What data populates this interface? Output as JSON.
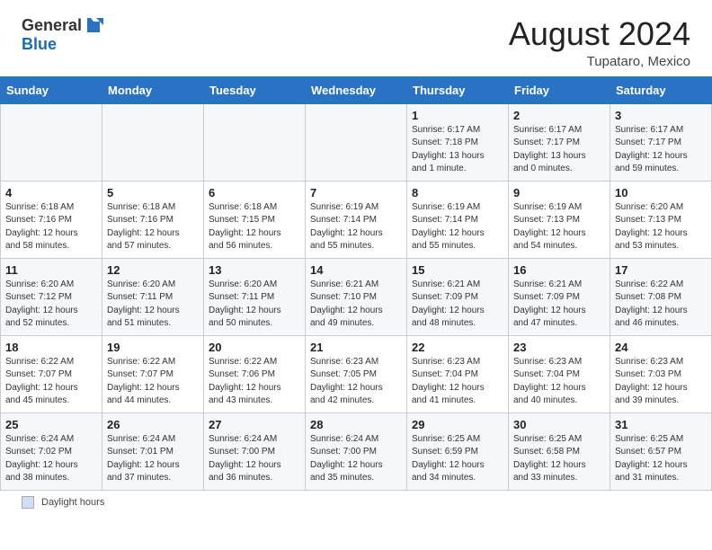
{
  "header": {
    "logo_line1": "General",
    "logo_line2": "Blue",
    "month_year": "August 2024",
    "location": "Tupataro, Mexico"
  },
  "days_of_week": [
    "Sunday",
    "Monday",
    "Tuesday",
    "Wednesday",
    "Thursday",
    "Friday",
    "Saturday"
  ],
  "weeks": [
    [
      {
        "day": "",
        "info": ""
      },
      {
        "day": "",
        "info": ""
      },
      {
        "day": "",
        "info": ""
      },
      {
        "day": "",
        "info": ""
      },
      {
        "day": "1",
        "info": "Sunrise: 6:17 AM\nSunset: 7:18 PM\nDaylight: 13 hours\nand 1 minute."
      },
      {
        "day": "2",
        "info": "Sunrise: 6:17 AM\nSunset: 7:17 PM\nDaylight: 13 hours\nand 0 minutes."
      },
      {
        "day": "3",
        "info": "Sunrise: 6:17 AM\nSunset: 7:17 PM\nDaylight: 12 hours\nand 59 minutes."
      }
    ],
    [
      {
        "day": "4",
        "info": "Sunrise: 6:18 AM\nSunset: 7:16 PM\nDaylight: 12 hours\nand 58 minutes."
      },
      {
        "day": "5",
        "info": "Sunrise: 6:18 AM\nSunset: 7:16 PM\nDaylight: 12 hours\nand 57 minutes."
      },
      {
        "day": "6",
        "info": "Sunrise: 6:18 AM\nSunset: 7:15 PM\nDaylight: 12 hours\nand 56 minutes."
      },
      {
        "day": "7",
        "info": "Sunrise: 6:19 AM\nSunset: 7:14 PM\nDaylight: 12 hours\nand 55 minutes."
      },
      {
        "day": "8",
        "info": "Sunrise: 6:19 AM\nSunset: 7:14 PM\nDaylight: 12 hours\nand 55 minutes."
      },
      {
        "day": "9",
        "info": "Sunrise: 6:19 AM\nSunset: 7:13 PM\nDaylight: 12 hours\nand 54 minutes."
      },
      {
        "day": "10",
        "info": "Sunrise: 6:20 AM\nSunset: 7:13 PM\nDaylight: 12 hours\nand 53 minutes."
      }
    ],
    [
      {
        "day": "11",
        "info": "Sunrise: 6:20 AM\nSunset: 7:12 PM\nDaylight: 12 hours\nand 52 minutes."
      },
      {
        "day": "12",
        "info": "Sunrise: 6:20 AM\nSunset: 7:11 PM\nDaylight: 12 hours\nand 51 minutes."
      },
      {
        "day": "13",
        "info": "Sunrise: 6:20 AM\nSunset: 7:11 PM\nDaylight: 12 hours\nand 50 minutes."
      },
      {
        "day": "14",
        "info": "Sunrise: 6:21 AM\nSunset: 7:10 PM\nDaylight: 12 hours\nand 49 minutes."
      },
      {
        "day": "15",
        "info": "Sunrise: 6:21 AM\nSunset: 7:09 PM\nDaylight: 12 hours\nand 48 minutes."
      },
      {
        "day": "16",
        "info": "Sunrise: 6:21 AM\nSunset: 7:09 PM\nDaylight: 12 hours\nand 47 minutes."
      },
      {
        "day": "17",
        "info": "Sunrise: 6:22 AM\nSunset: 7:08 PM\nDaylight: 12 hours\nand 46 minutes."
      }
    ],
    [
      {
        "day": "18",
        "info": "Sunrise: 6:22 AM\nSunset: 7:07 PM\nDaylight: 12 hours\nand 45 minutes."
      },
      {
        "day": "19",
        "info": "Sunrise: 6:22 AM\nSunset: 7:07 PM\nDaylight: 12 hours\nand 44 minutes."
      },
      {
        "day": "20",
        "info": "Sunrise: 6:22 AM\nSunset: 7:06 PM\nDaylight: 12 hours\nand 43 minutes."
      },
      {
        "day": "21",
        "info": "Sunrise: 6:23 AM\nSunset: 7:05 PM\nDaylight: 12 hours\nand 42 minutes."
      },
      {
        "day": "22",
        "info": "Sunrise: 6:23 AM\nSunset: 7:04 PM\nDaylight: 12 hours\nand 41 minutes."
      },
      {
        "day": "23",
        "info": "Sunrise: 6:23 AM\nSunset: 7:04 PM\nDaylight: 12 hours\nand 40 minutes."
      },
      {
        "day": "24",
        "info": "Sunrise: 6:23 AM\nSunset: 7:03 PM\nDaylight: 12 hours\nand 39 minutes."
      }
    ],
    [
      {
        "day": "25",
        "info": "Sunrise: 6:24 AM\nSunset: 7:02 PM\nDaylight: 12 hours\nand 38 minutes."
      },
      {
        "day": "26",
        "info": "Sunrise: 6:24 AM\nSunset: 7:01 PM\nDaylight: 12 hours\nand 37 minutes."
      },
      {
        "day": "27",
        "info": "Sunrise: 6:24 AM\nSunset: 7:00 PM\nDaylight: 12 hours\nand 36 minutes."
      },
      {
        "day": "28",
        "info": "Sunrise: 6:24 AM\nSunset: 7:00 PM\nDaylight: 12 hours\nand 35 minutes."
      },
      {
        "day": "29",
        "info": "Sunrise: 6:25 AM\nSunset: 6:59 PM\nDaylight: 12 hours\nand 34 minutes."
      },
      {
        "day": "30",
        "info": "Sunrise: 6:25 AM\nSunset: 6:58 PM\nDaylight: 12 hours\nand 33 minutes."
      },
      {
        "day": "31",
        "info": "Sunrise: 6:25 AM\nSunset: 6:57 PM\nDaylight: 12 hours\nand 31 minutes."
      }
    ]
  ],
  "footer": {
    "legend_label": "Daylight hours"
  }
}
